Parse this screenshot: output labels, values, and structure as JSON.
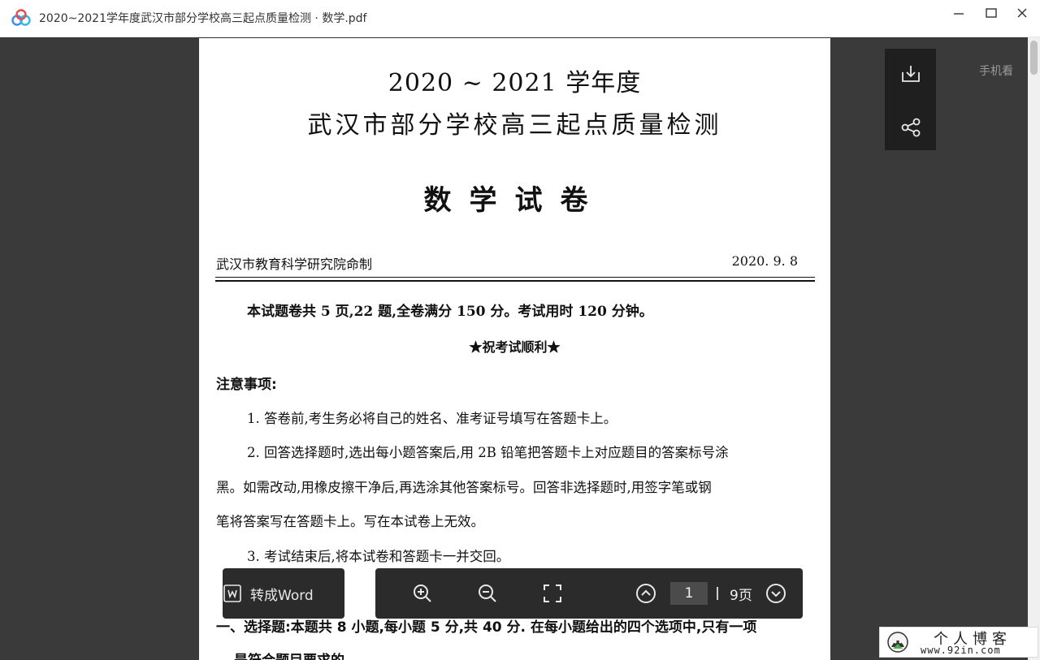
{
  "window": {
    "title": "2020~2021学年度武汉市部分学校高三起点质量检测 · 数学.pdf"
  },
  "page": {
    "title_line1": "2020 ~ 2021 学年度",
    "title_line2": "武汉市部分学校高三起点质量检测",
    "title_line3": "数学试卷",
    "issuer": "武汉市教育科学研究院命制",
    "date": "2020. 9. 8",
    "intro": "本试题卷共 5 页,22 题,全卷满分 150 分。考试用时 120 分钟。",
    "good_luck": "★祝考试顺利★",
    "notice_heading": "注意事项:",
    "notice_lines": [
      "1. 答卷前,考生务必将自己的姓名、准考证号填写在答题卡上。",
      "2. 回答选择题时,选出每小题答案后,用 2B 铅笔把答题卡上对应题目的答案标号涂",
      "黑。如需改动,用橡皮擦干净后,再选涂其他答案标号。回答非选择题时,用签字笔或钢",
      "笔将答案写在答题卡上。写在本试卷上无效。",
      "3. 考试结束后,将本试卷和答题卡一并交回。"
    ],
    "section_line1": "一、选择题:本题共 8 小题,每小题 5 分,共 40 分. 在每小题给出的四个选项中,只有一项",
    "section_line2": "是符合题目要求的."
  },
  "side_tools": {
    "mobile_label": "手机看",
    "download_icon": "download-icon",
    "share_icon": "share-icon"
  },
  "toolbar": {
    "convert_label": "转成Word",
    "current_page": "1",
    "total_pages": "9页"
  },
  "watermark": {
    "name": "个人博客",
    "url": "www.92in.com"
  },
  "colors": {
    "viewer_bg": "#3a3a3a",
    "toolbar_bg": "#2b2b2b",
    "page_bg": "#ffffff",
    "logo_blue": "#3c8cf0"
  }
}
